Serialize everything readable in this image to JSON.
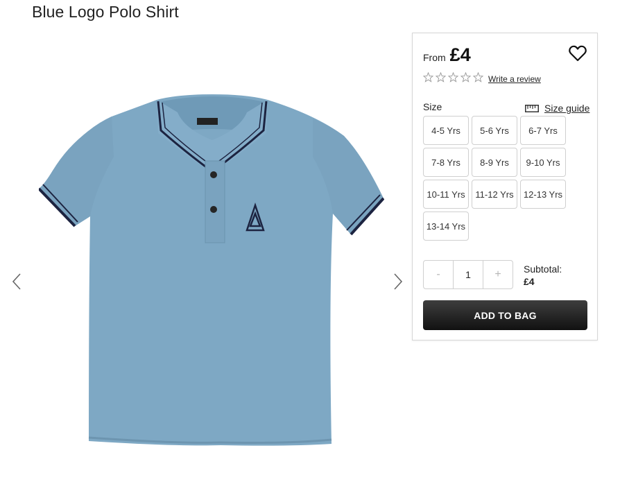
{
  "product": {
    "title": "Blue Logo Polo Shirt"
  },
  "purchase": {
    "from_label": "From",
    "price": "£4",
    "rating_stars": 0,
    "rating_max": 5,
    "review_link": "Write a review",
    "size_label": "Size",
    "size_guide": "Size guide",
    "sizes": [
      "4-5 Yrs",
      "5-6 Yrs",
      "6-7 Yrs",
      "7-8 Yrs",
      "8-9 Yrs",
      "9-10 Yrs",
      "10-11 Yrs",
      "11-12 Yrs",
      "12-13 Yrs",
      "13-14 Yrs"
    ],
    "quantity": {
      "minus": "-",
      "value": "1",
      "plus": "+"
    },
    "subtotal_label": "Subtotal:",
    "subtotal_value": "£4",
    "add_to_bag": "ADD TO BAG"
  },
  "colors": {
    "shirt": "#7ea8c4",
    "collar_stripe": "#1c2340",
    "button_dark": "#262626"
  },
  "icons": {
    "prev": "chevron-left-icon",
    "next": "chevron-right-icon",
    "wishlist": "heart-icon",
    "size_guide": "ruler-icon",
    "star": "star-outline-icon"
  }
}
